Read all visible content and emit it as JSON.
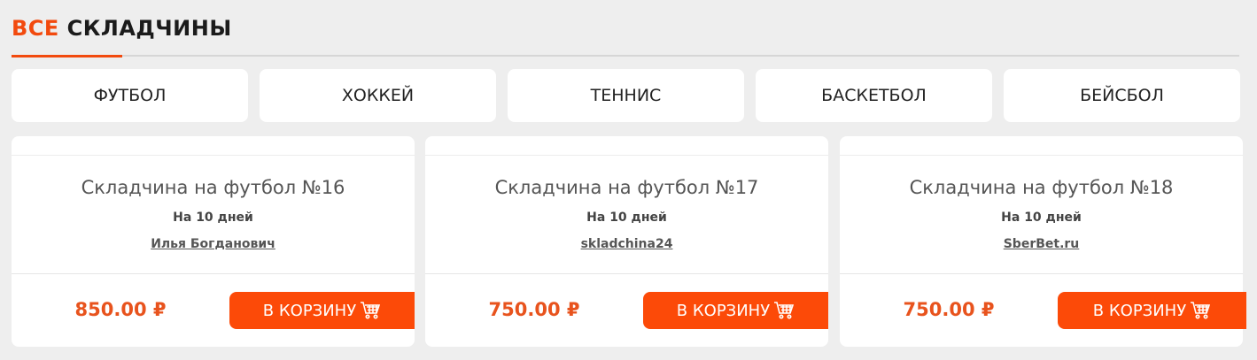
{
  "header": {
    "accent": "Все",
    "rest": "складчины"
  },
  "tabs": [
    {
      "label": "Футбол"
    },
    {
      "label": "Хоккей"
    },
    {
      "label": "Теннис"
    },
    {
      "label": "Баскетбол"
    },
    {
      "label": "Бейсбол"
    }
  ],
  "cards": [
    {
      "title": "Складчина на футбол №16",
      "duration": "На 10 дней",
      "author": "Илья Богданович",
      "price": "850.00 ₽",
      "button": "В корзину"
    },
    {
      "title": "Складчина на футбол №17",
      "duration": "На 10 дней",
      "author": "skladchina24",
      "price": "750.00 ₽",
      "button": "В корзину"
    },
    {
      "title": "Складчина на футбол №18",
      "duration": "На 10 дней",
      "author": "SberBet.ru",
      "price": "750.00 ₽",
      "button": "В корзину"
    }
  ],
  "colors": {
    "accent": "#f24a0e",
    "button": "#fc4a08",
    "price": "#e8531d",
    "background": "#eeeeee"
  },
  "icons": {
    "cart": "cart-icon"
  }
}
